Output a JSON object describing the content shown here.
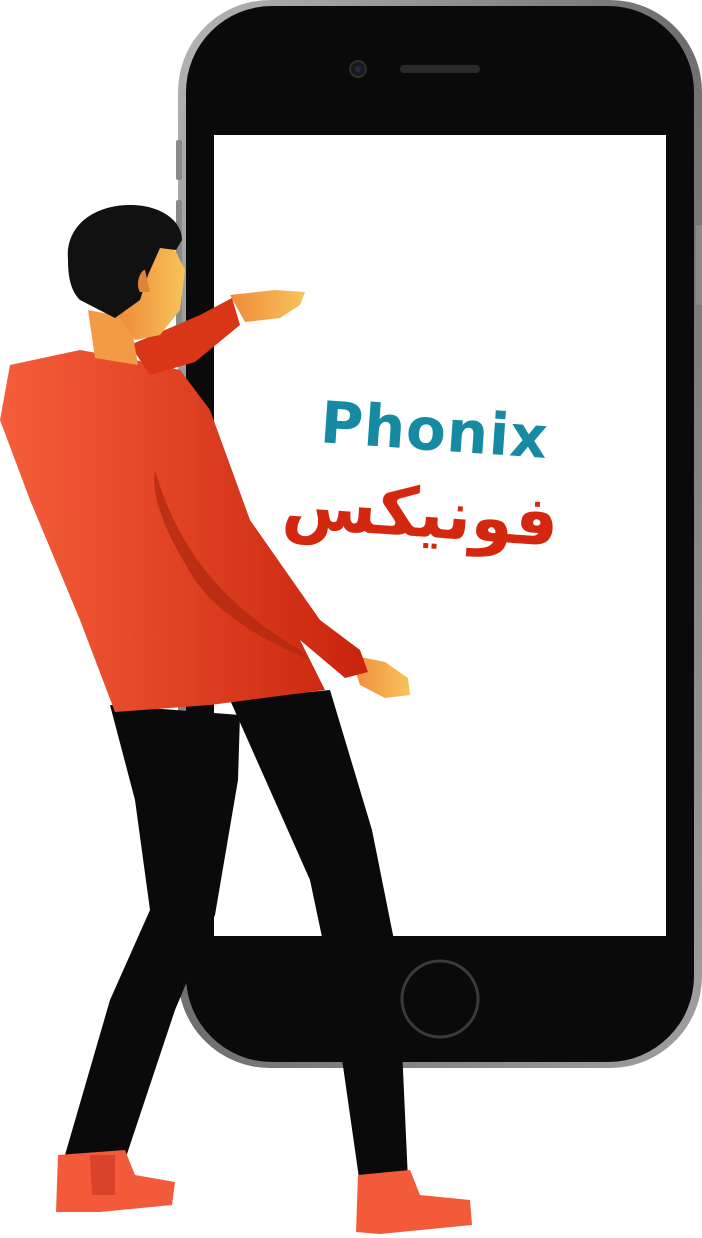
{
  "logo": {
    "name_en": "Phonix",
    "name_ar": "فونیکس",
    "color_en": "#168aa2",
    "color_ar": "#d4270f"
  },
  "icons": [
    "smartphone-icon",
    "person-illustration"
  ],
  "colors": {
    "phone_frame": "#0a0a0a",
    "phone_bezel": "#8f8f8f",
    "screen": "#ffffff",
    "shirt": "#e0401f",
    "shirt_light": "#f55e3a",
    "pants": "#0a0a0a",
    "skin": "#f6a94a",
    "hair": "#111111",
    "shoes": "#f25a3a"
  }
}
